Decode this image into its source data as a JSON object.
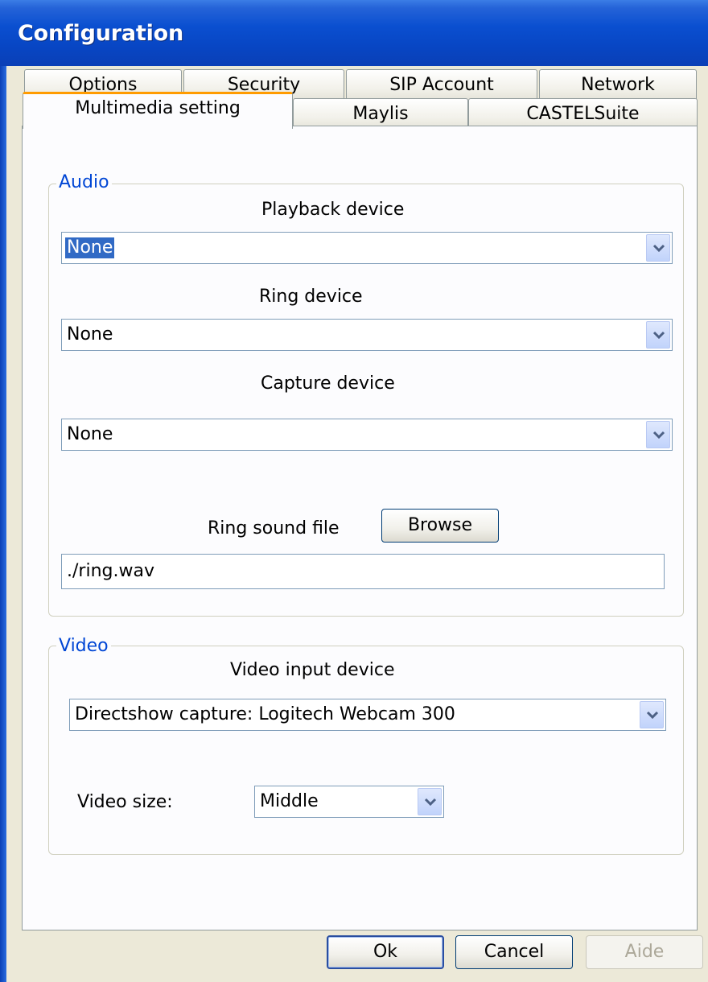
{
  "window": {
    "title": "Configuration"
  },
  "tabs": {
    "row_back": [
      "Options",
      "Security",
      "SIP Account",
      "Network"
    ],
    "row_front": [
      "Multimedia setting",
      "Maylis",
      "CASTELSuite"
    ],
    "active": "Multimedia setting"
  },
  "audio": {
    "legend": "Audio",
    "playback_label": "Playback device",
    "playback_value": "None",
    "ring_label": "Ring device",
    "ring_value": "None",
    "capture_label": "Capture device",
    "capture_value": "None",
    "ring_sound_label": "Ring sound file",
    "browse_label": "Browse",
    "ring_sound_value": "./ring.wav"
  },
  "video": {
    "legend": "Video",
    "input_label": "Video input device",
    "input_value": "Directshow capture: Logitech Webcam 300",
    "size_label": "Video size:",
    "size_value": "Middle"
  },
  "footer": {
    "ok_label": "Ok",
    "cancel_label": "Cancel",
    "help_label": "Aide"
  },
  "icons": {
    "dropdown": "chevron-down-icon"
  },
  "colors": {
    "titlebar": "#0a4fd0",
    "legend_text": "#0046d5",
    "active_tab_accent": "#ff9b00",
    "selection": "#316ac5"
  }
}
